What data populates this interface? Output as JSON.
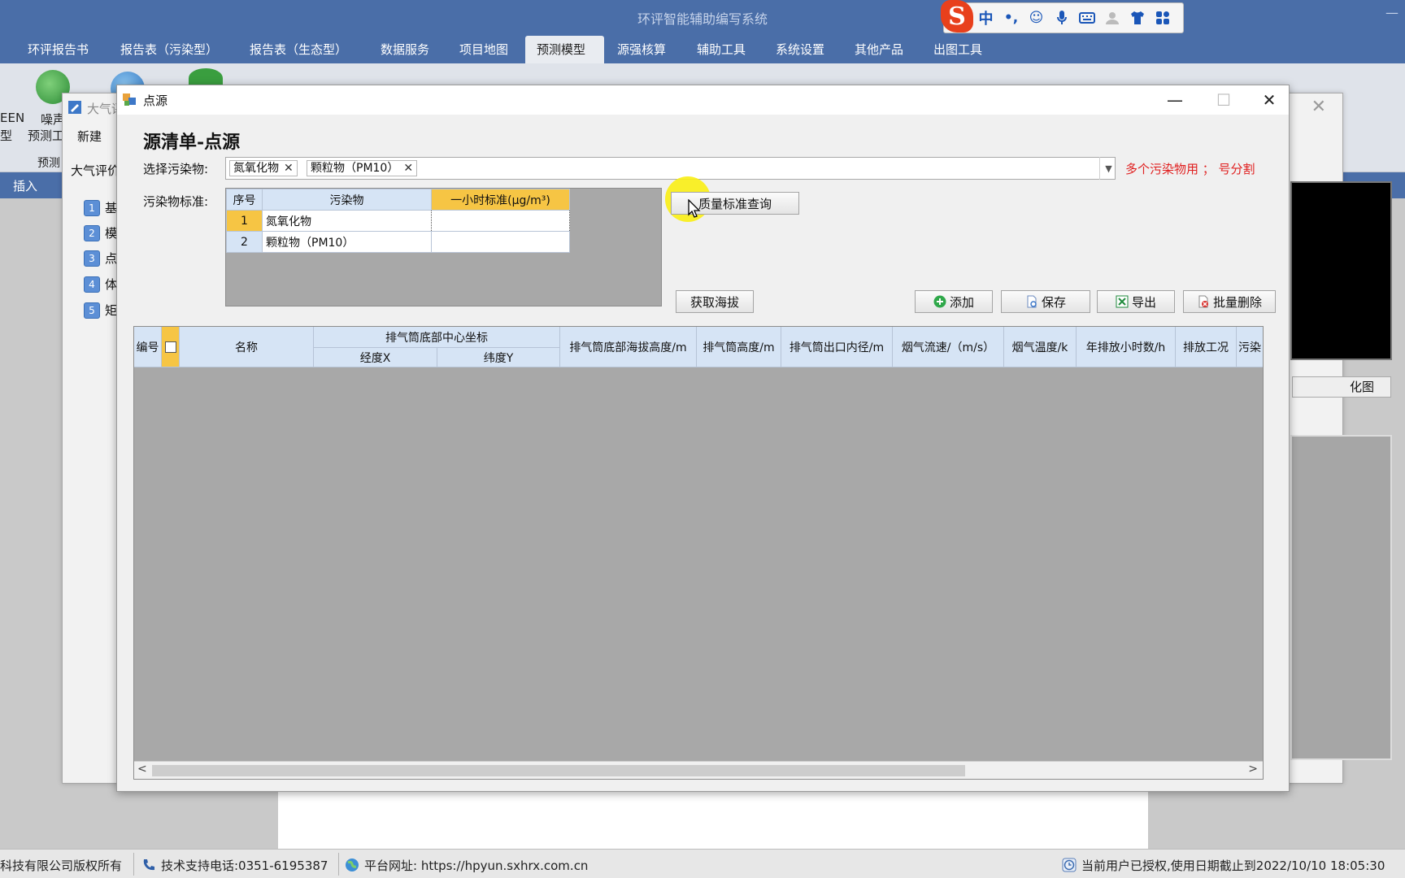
{
  "app": {
    "title": "环评智能辅助编写系统",
    "minimize": "—"
  },
  "ime": {
    "zh": "中",
    "punct": "•,",
    "emoji": "☺",
    "mic": "🎤",
    "keyboard": "⌨",
    "skin": "👕",
    "apps": "▦",
    "logo": "S"
  },
  "menu": [
    "环评报告书",
    "报告表（污染型）",
    "报告表（生态型）",
    "数据服务",
    "项目地图",
    "预测模型",
    "源强核算",
    "辅助工具",
    "系统设置",
    "其他产品",
    "出图工具"
  ],
  "ribbon": {
    "item1_label_a": "EEN",
    "item1_label_b": "型",
    "item2_label_a": "噪声",
    "item2_label_b": "预测工",
    "group_label": "预测",
    "insert": "插入"
  },
  "bg_window": {
    "title": "大气评",
    "close": "✕",
    "new": "新建",
    "section": "大气评价",
    "steps": [
      {
        "num": "1",
        "label": "基"
      },
      {
        "num": "2",
        "label": "模"
      },
      {
        "num": "3",
        "label": "点"
      },
      {
        "num": "4",
        "label": "体"
      },
      {
        "num": "5",
        "label": "矩"
      }
    ],
    "graph_btn": "化图"
  },
  "dialog": {
    "title": "点源",
    "minimize": "—",
    "maximize": "☐",
    "close": "✕",
    "heading": "源清单-点源",
    "select_label": "选择污染物:",
    "selected_pollutants": [
      "氮氧化物",
      "颗粒物（PM10）"
    ],
    "chip_remove": "✕",
    "hint": "多个污染物用 ； 号分割",
    "std_label": "污染物标准:",
    "std_table": {
      "headers": [
        "序号",
        "污染物",
        "一小时标准(μg/m³)"
      ],
      "rows": [
        {
          "no": "1",
          "name": "氮氧化物",
          "value": ""
        },
        {
          "no": "2",
          "name": "颗粒物（PM10）",
          "value": ""
        }
      ]
    },
    "buttons": {
      "quality": "质量标准查询",
      "altitude": "获取海拔",
      "add": "添加",
      "save": "保存",
      "export": "导出",
      "batch_delete": "批量删除"
    },
    "grid": {
      "col_no": "编号",
      "col_name": "名称",
      "col_coord": "排气筒底部中心坐标",
      "col_lon": "经度X",
      "col_lat": "纬度Y",
      "col_base_alt": "排气筒底部海拔高度/m",
      "col_height": "排气筒高度/m",
      "col_diameter": "排气筒出口内径/m",
      "col_velocity": "烟气流速/（m/s）",
      "col_temp": "烟气温度/k",
      "col_hours": "年排放小时数/h",
      "col_condition": "排放工况",
      "col_pollutant": "污染",
      "scroll_left": "<",
      "scroll_right": ">"
    }
  },
  "status": {
    "copyright": "科技有限公司版权所有",
    "phone": "技术支持电话:0351-6195387",
    "site": "平台网址:  https://hpyun.sxhrx.com.cn",
    "license": "当前用户已授权,使用日期截止到2022/10/10 18:05:30"
  }
}
